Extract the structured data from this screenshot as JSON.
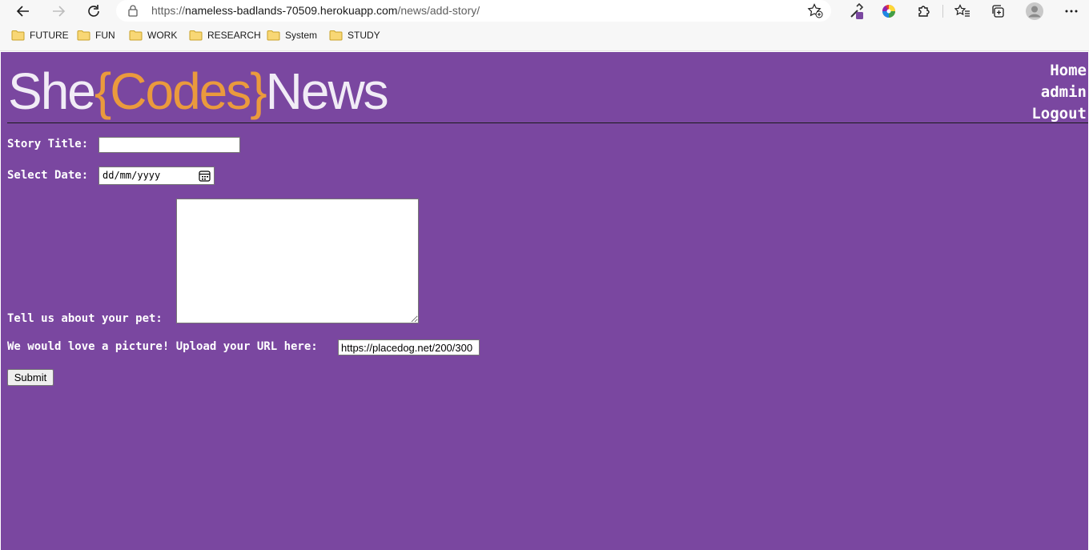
{
  "browser": {
    "url_prefix": "https://",
    "url_host": "nameless-badlands-70509.herokuapp.com",
    "url_path": "/news/add-story/",
    "bookmarks": [
      "FUTURE",
      "FUN",
      "WORK",
      "RESEARCH",
      "System",
      "STUDY"
    ],
    "icons": {
      "back": "arrow-left-icon",
      "forward": "arrow-right-icon",
      "reload": "reload-icon",
      "lock": "lock-icon",
      "favorite": "star-plus-icon",
      "extension_1": "eyedropper-icon",
      "extension_2": "color-wheel-icon",
      "extensions": "puzzle-icon",
      "favorites": "favorites-icon",
      "collections": "collections-icon",
      "profile": "avatar-icon",
      "more": "more-icon"
    }
  },
  "site": {
    "logo": {
      "part1": "She",
      "part2": "{Codes}",
      "part3": "News"
    },
    "nav": {
      "home": "Home",
      "admin": "admin",
      "logout": "Logout"
    }
  },
  "form": {
    "title_label": "Story Title:",
    "title_value": "",
    "date_label": "Select Date:",
    "date_placeholder": "dd/mm/yyyy",
    "pet_label": "Tell us about your pet:",
    "pet_value": "",
    "image_label": "We would love a picture! Upload your URL here:",
    "image_value": "https://placedog.net/200/300",
    "submit_label": "Submit"
  },
  "colors": {
    "page_background": "#7a47a0",
    "logo_accent": "#ea9a3d",
    "logo_text": "#f1ecf6"
  }
}
